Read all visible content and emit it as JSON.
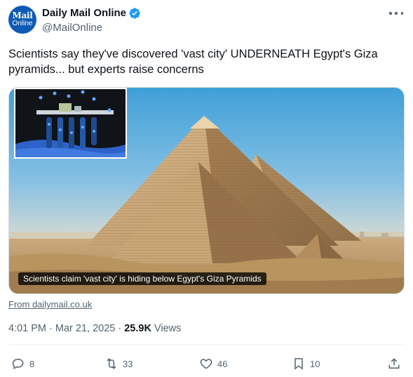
{
  "author": {
    "display_name": "Daily Mail Online",
    "handle": "@MailOnline",
    "avatar_line1": "Mail",
    "avatar_line2": "Online"
  },
  "tweet": {
    "text": "Scientists say they've discovered 'vast city' UNDERNEATH Egypt's Giza pyramids... but experts raise concerns"
  },
  "card": {
    "caption": "Scientists claim 'vast city' is hiding below Egypt's Giza Pyramids",
    "source": "From dailymail.co.uk"
  },
  "meta": {
    "timestamp": "4:01 PM · Mar 21, 2025",
    "separator": "·",
    "views_count": "25.9K",
    "views_label": "Views"
  },
  "actions": {
    "replies": "8",
    "reposts": "33",
    "likes": "46",
    "bookmarks": "10"
  },
  "colors": {
    "verified": "#1d9bf0",
    "secondary_text": "#536471",
    "avatar_bg": "#0d5bb5"
  }
}
